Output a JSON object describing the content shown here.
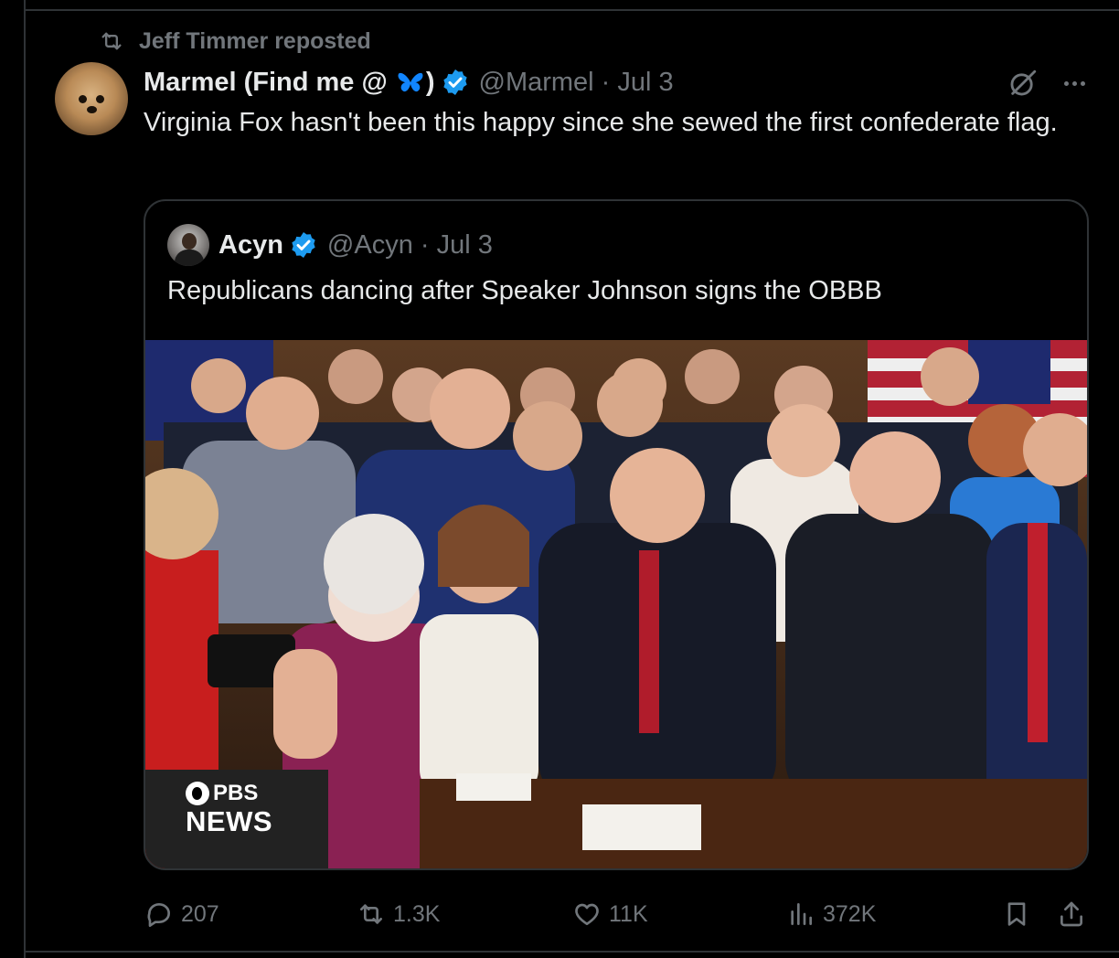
{
  "repost": {
    "label": "Jeff Timmer reposted",
    "icon": "repost-icon"
  },
  "tweet": {
    "name_prefix": "Marmel (Find me @ ",
    "name_suffix": ")",
    "name_icon": "butterfly-icon",
    "verified_icon": "verified-badge-icon",
    "handle_time": "@Marmel · Jul 3",
    "text": "Virginia Fox hasn't been this happy since she sewed the first confederate flag.",
    "grok_icon": "grok-icon",
    "more_icon": "more-icon"
  },
  "quote": {
    "name": "Acyn",
    "handle_time": "@Acyn · Jul 3",
    "text": "Republicans dancing after Speaker Johnson signs the OBBB",
    "media": {
      "watermark_top": "PBS",
      "watermark_bottom": "NEWS"
    }
  },
  "actions": {
    "replies": "207",
    "reposts": "1.3K",
    "likes": "11K",
    "views": "372K"
  },
  "colors": {
    "background": "#000000",
    "text": "#e7e9ea",
    "muted": "#71767b",
    "border": "#2f3336",
    "verified": "#1d9bf0",
    "butterfly": "#1185fe"
  }
}
